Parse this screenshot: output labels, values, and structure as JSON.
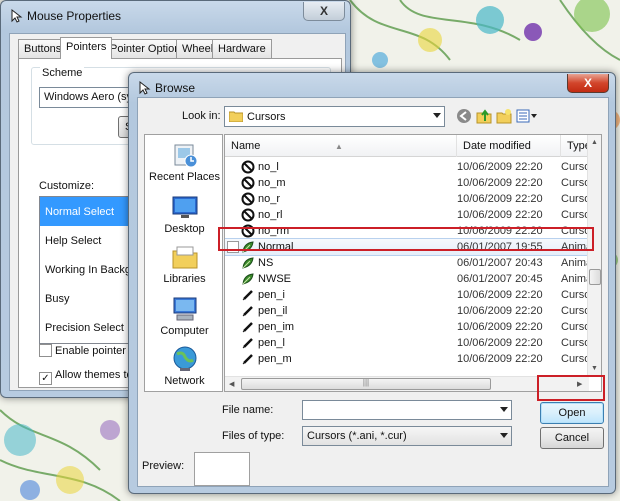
{
  "mouse_properties": {
    "title": "Mouse Properties",
    "close_glyph": "X",
    "tabs": [
      {
        "label": "Buttons"
      },
      {
        "label": "Pointers"
      },
      {
        "label": "Pointer Options"
      },
      {
        "label": "Wheel"
      },
      {
        "label": "Hardware"
      }
    ],
    "selected_tab": "Pointers",
    "scheme_label": "Scheme",
    "scheme_value": "Windows Aero (system",
    "scheme_button_partial": "S",
    "customize_label": "Customize:",
    "cursor_items": [
      {
        "label": "Normal Select"
      },
      {
        "label": "Help Select"
      },
      {
        "label": "Working In Background"
      },
      {
        "label": "Busy"
      },
      {
        "label": "Precision Select"
      }
    ],
    "selected_cursor": "Normal Select",
    "checkbox_shadow": {
      "label": "Enable pointer shado",
      "checked": false
    },
    "checkbox_themes": {
      "label": "Allow themes to chan",
      "checked": true
    }
  },
  "browse": {
    "title": "Browse",
    "close_glyph": "X",
    "look_in_label": "Look in:",
    "look_in_value": "Cursors",
    "places": [
      {
        "label": "Recent Places"
      },
      {
        "label": "Desktop"
      },
      {
        "label": "Libraries"
      },
      {
        "label": "Computer"
      },
      {
        "label": "Network"
      }
    ],
    "columns": {
      "name": "Name",
      "date": "Date modified",
      "type": "Type"
    },
    "files": [
      {
        "name": "no_l",
        "date": "10/06/2009 22:20",
        "type": "Cursor",
        "icon": "no-entry-icon"
      },
      {
        "name": "no_m",
        "date": "10/06/2009 22:20",
        "type": "Cursor",
        "icon": "no-entry-icon"
      },
      {
        "name": "no_r",
        "date": "10/06/2009 22:20",
        "type": "Cursor",
        "icon": "no-entry-icon"
      },
      {
        "name": "no_rl",
        "date": "10/06/2009 22:20",
        "type": "Cursor",
        "icon": "no-entry-icon"
      },
      {
        "name": "no_rm",
        "date": "10/06/2009 22:20",
        "type": "Cursor",
        "icon": "no-entry-icon"
      },
      {
        "name": "Normal",
        "date": "06/01/2007 19:55",
        "type": "Anima",
        "icon": "animated-leaf-icon"
      },
      {
        "name": "NS",
        "date": "06/01/2007 20:43",
        "type": "Anima",
        "icon": "animated-leaf-icon"
      },
      {
        "name": "NWSE",
        "date": "06/01/2007 20:45",
        "type": "Anima",
        "icon": "animated-leaf-icon"
      },
      {
        "name": "pen_i",
        "date": "10/06/2009 22:20",
        "type": "Cursor",
        "icon": "pen-icon"
      },
      {
        "name": "pen_il",
        "date": "10/06/2009 22:20",
        "type": "Cursor",
        "icon": "pen-icon"
      },
      {
        "name": "pen_im",
        "date": "10/06/2009 22:20",
        "type": "Cursor",
        "icon": "pen-icon"
      },
      {
        "name": "pen_l",
        "date": "10/06/2009 22:20",
        "type": "Cursor",
        "icon": "pen-icon"
      },
      {
        "name": "pen_m",
        "date": "10/06/2009 22:20",
        "type": "Cursor",
        "icon": "pen-icon"
      }
    ],
    "highlighted_file": "Normal",
    "file_name_label": "File name:",
    "file_name_value": "",
    "files_of_type_label": "Files of type:",
    "files_of_type_value": "Cursors (*.ani, *.cur)",
    "open_label": "Open",
    "cancel_label": "Cancel",
    "preview_label": "Preview:"
  },
  "colors": {
    "selection_blue": "#3399ff",
    "annotation_red": "#cc1f27",
    "aero_frame": "#b7cbe0"
  }
}
